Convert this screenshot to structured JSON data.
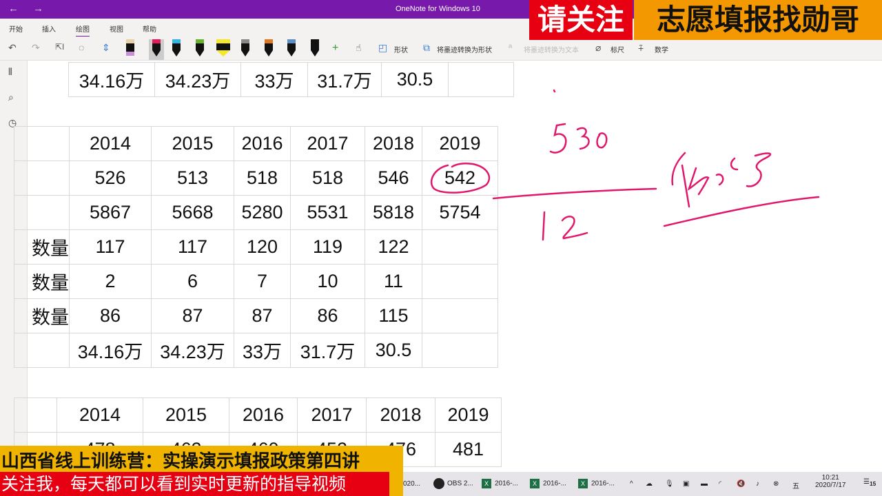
{
  "window": {
    "title": "OneNote for Windows 10",
    "back": "←",
    "forward": "→"
  },
  "ribbon": {
    "tabs": [
      "开始",
      "插入",
      "绘图",
      "视图",
      "帮助"
    ],
    "active_tab": "绘图",
    "tools": {
      "shapes": "形状",
      "ink_to_shape": "将墨迹转换为形状",
      "ink_to_text": "将墨迹转换为文本",
      "ruler": "标尺",
      "math": "数学"
    },
    "pen_colors": [
      "#222222",
      "#e8185e",
      "#2fb5e8",
      "#6ab42d",
      "#f7e72a",
      "#888888",
      "#e0781f",
      "#5a8fc9",
      "#111111"
    ]
  },
  "table_top": {
    "row": [
      "34.16万",
      "34.23万",
      "33万",
      "31.7万",
      "30.5",
      ""
    ]
  },
  "table_main": {
    "rows": [
      {
        "label": "",
        "cells": [
          "2014",
          "2015",
          "2016",
          "2017",
          "2018",
          "2019"
        ]
      },
      {
        "label": "",
        "cells": [
          "526",
          "513",
          "518",
          "518",
          "546",
          "542"
        ]
      },
      {
        "label": "",
        "cells": [
          "5867",
          "5668",
          "5280",
          "5531",
          "5818",
          "5754"
        ]
      },
      {
        "label": "数量",
        "cells": [
          "117",
          "117",
          "120",
          "119",
          "122",
          ""
        ]
      },
      {
        "label": "数量",
        "cells": [
          "2",
          "6",
          "7",
          "10",
          "11",
          ""
        ]
      },
      {
        "label": "数量",
        "cells": [
          "86",
          "87",
          "87",
          "86",
          "115",
          ""
        ]
      },
      {
        "label": "",
        "cells": [
          "34.16万",
          "34.23万",
          "33万",
          "31.7万",
          "30.5",
          ""
        ]
      }
    ]
  },
  "table_bottom": {
    "rows": [
      {
        "label": "",
        "cells": [
          "2014",
          "2015",
          "2016",
          "2017",
          "2018",
          "2019"
        ]
      },
      {
        "label": "",
        "cells": [
          "478",
          "462",
          "460",
          "452",
          "476",
          "481"
        ]
      }
    ]
  },
  "overlays": {
    "follow": "请关注",
    "brand": "志愿填报找勋哥",
    "banner_line1": "山西省线上训练营：实操演示填报政策第四讲",
    "banner_line2": "关注我，每天都可以看到实时更新的指导视频"
  },
  "taskbar": {
    "items": [
      "020...",
      "OBS 2...",
      "2016-...",
      "2016-...",
      "2016-..."
    ],
    "time": "10:21",
    "date": "2020/7/17",
    "ime": "五",
    "notifications": "15"
  },
  "colors": {
    "accent": "#7719aa",
    "ink": "#e0186c"
  }
}
